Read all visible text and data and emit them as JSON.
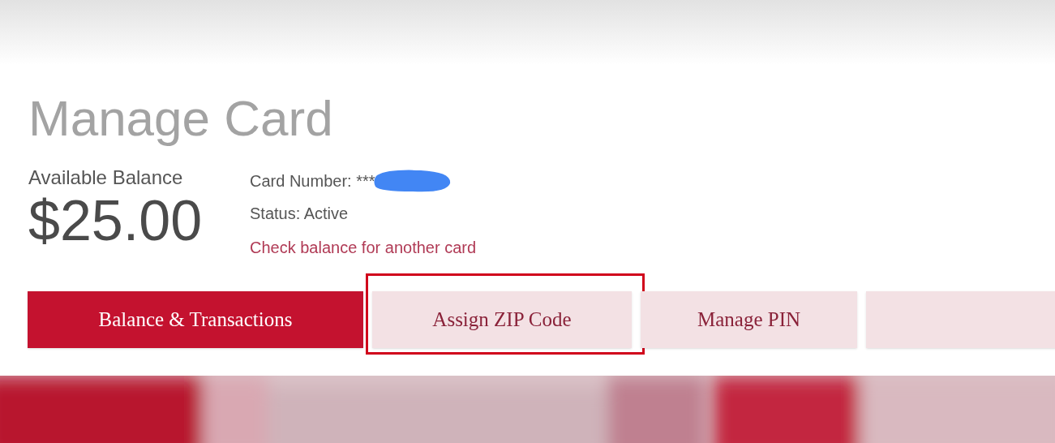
{
  "title": "Manage Card",
  "balance": {
    "label": "Available Balance",
    "amount": "$25.00"
  },
  "card_info": {
    "number": "Card Number: ***",
    "status": "Status: Active",
    "link": "Check balance for another card"
  },
  "tabs": [
    {
      "label": "Balance & Transactions",
      "selected": true,
      "highlighted": false
    },
    {
      "label": "Assign ZIP Code",
      "selected": false,
      "highlighted": true
    },
    {
      "label": "Manage PIN",
      "selected": false,
      "highlighted": false
    },
    {
      "selected": false,
      "highlighted": false
    }
  ]
}
